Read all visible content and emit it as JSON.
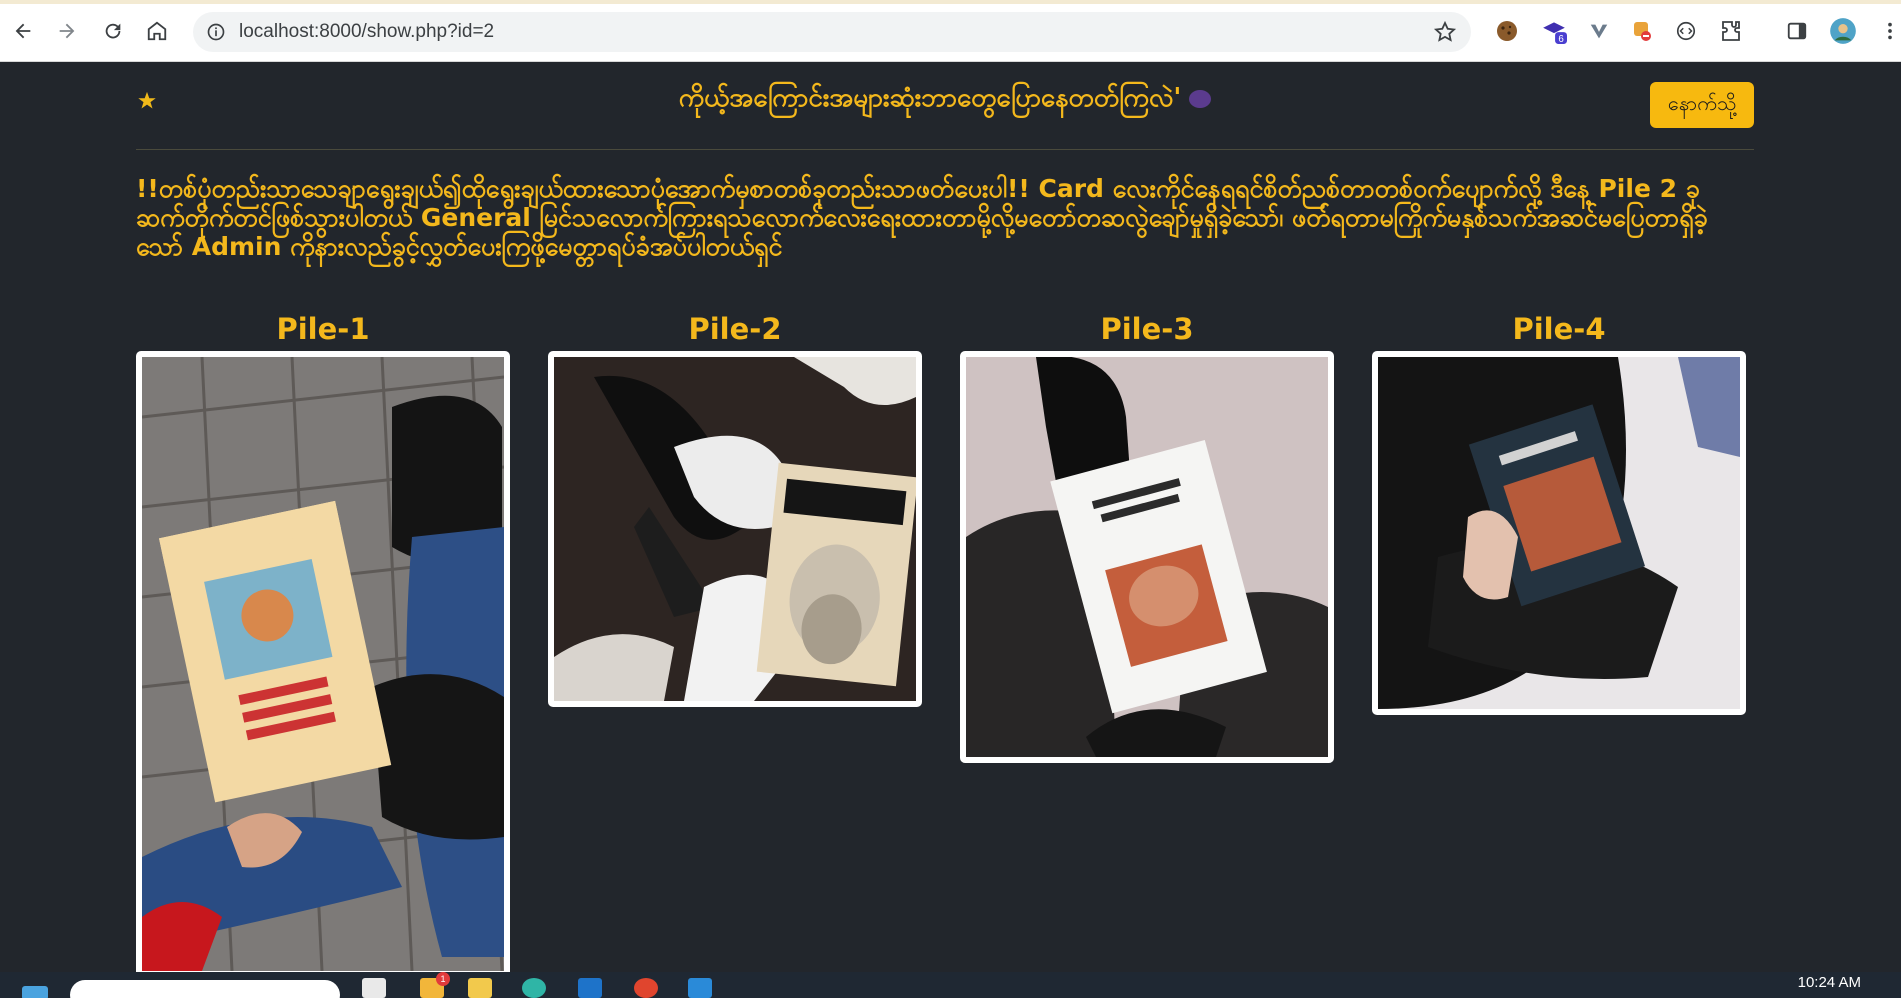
{
  "browser": {
    "url": "localhost:8000/show.php?id=2",
    "extension_badge": "6"
  },
  "header": {
    "title": "ကိုယ့်အကြောင်းအများဆုံးဘာတွေပြောနေတတ်ကြလဲ'",
    "back_label": "နောက်သို့"
  },
  "intro": "!!တစ်ပုံတည်းသာသေချာရွေးချယ်၍ထိုရွေးချယ်ထားသောပုံအောက်မှစာတစ်ခုတည်းသာဖတ်ပေးပါ!! Card လေးကိုင်နေရရင်စိတ်ညစ်တာတစ်ဝက်ပျောက်လို့ ဒီနေ့ Pile 2 ခုဆက်တိုက်တင်ဖြစ်သွားပါတယ် General မြင်သလောက်ကြားရသလောက်လေးရေးထားတာမို့လို့မတော်တဆလွဲချော်မှုရှိခဲ့သော်၊ ဖတ်ရတာမကြိုက်မနှစ်သက်အဆင်မပြေတာရှိခဲ့သော် Admin ကိုနားလည်ခွင့်လွှတ်ပေးကြဖို့မေတ္တာရပ်ခံအပ်ပါတယ်ရှင်",
  "piles": [
    {
      "label": "Pile-1"
    },
    {
      "label": "Pile-2"
    },
    {
      "label": "Pile-3"
    },
    {
      "label": "Pile-4"
    }
  ],
  "taskbar": {
    "time": "10:24 AM",
    "notification_badge": "1"
  },
  "colors": {
    "page_bg": "#22262c",
    "accent": "#f4b81c",
    "button_bg": "#f7b90f"
  }
}
